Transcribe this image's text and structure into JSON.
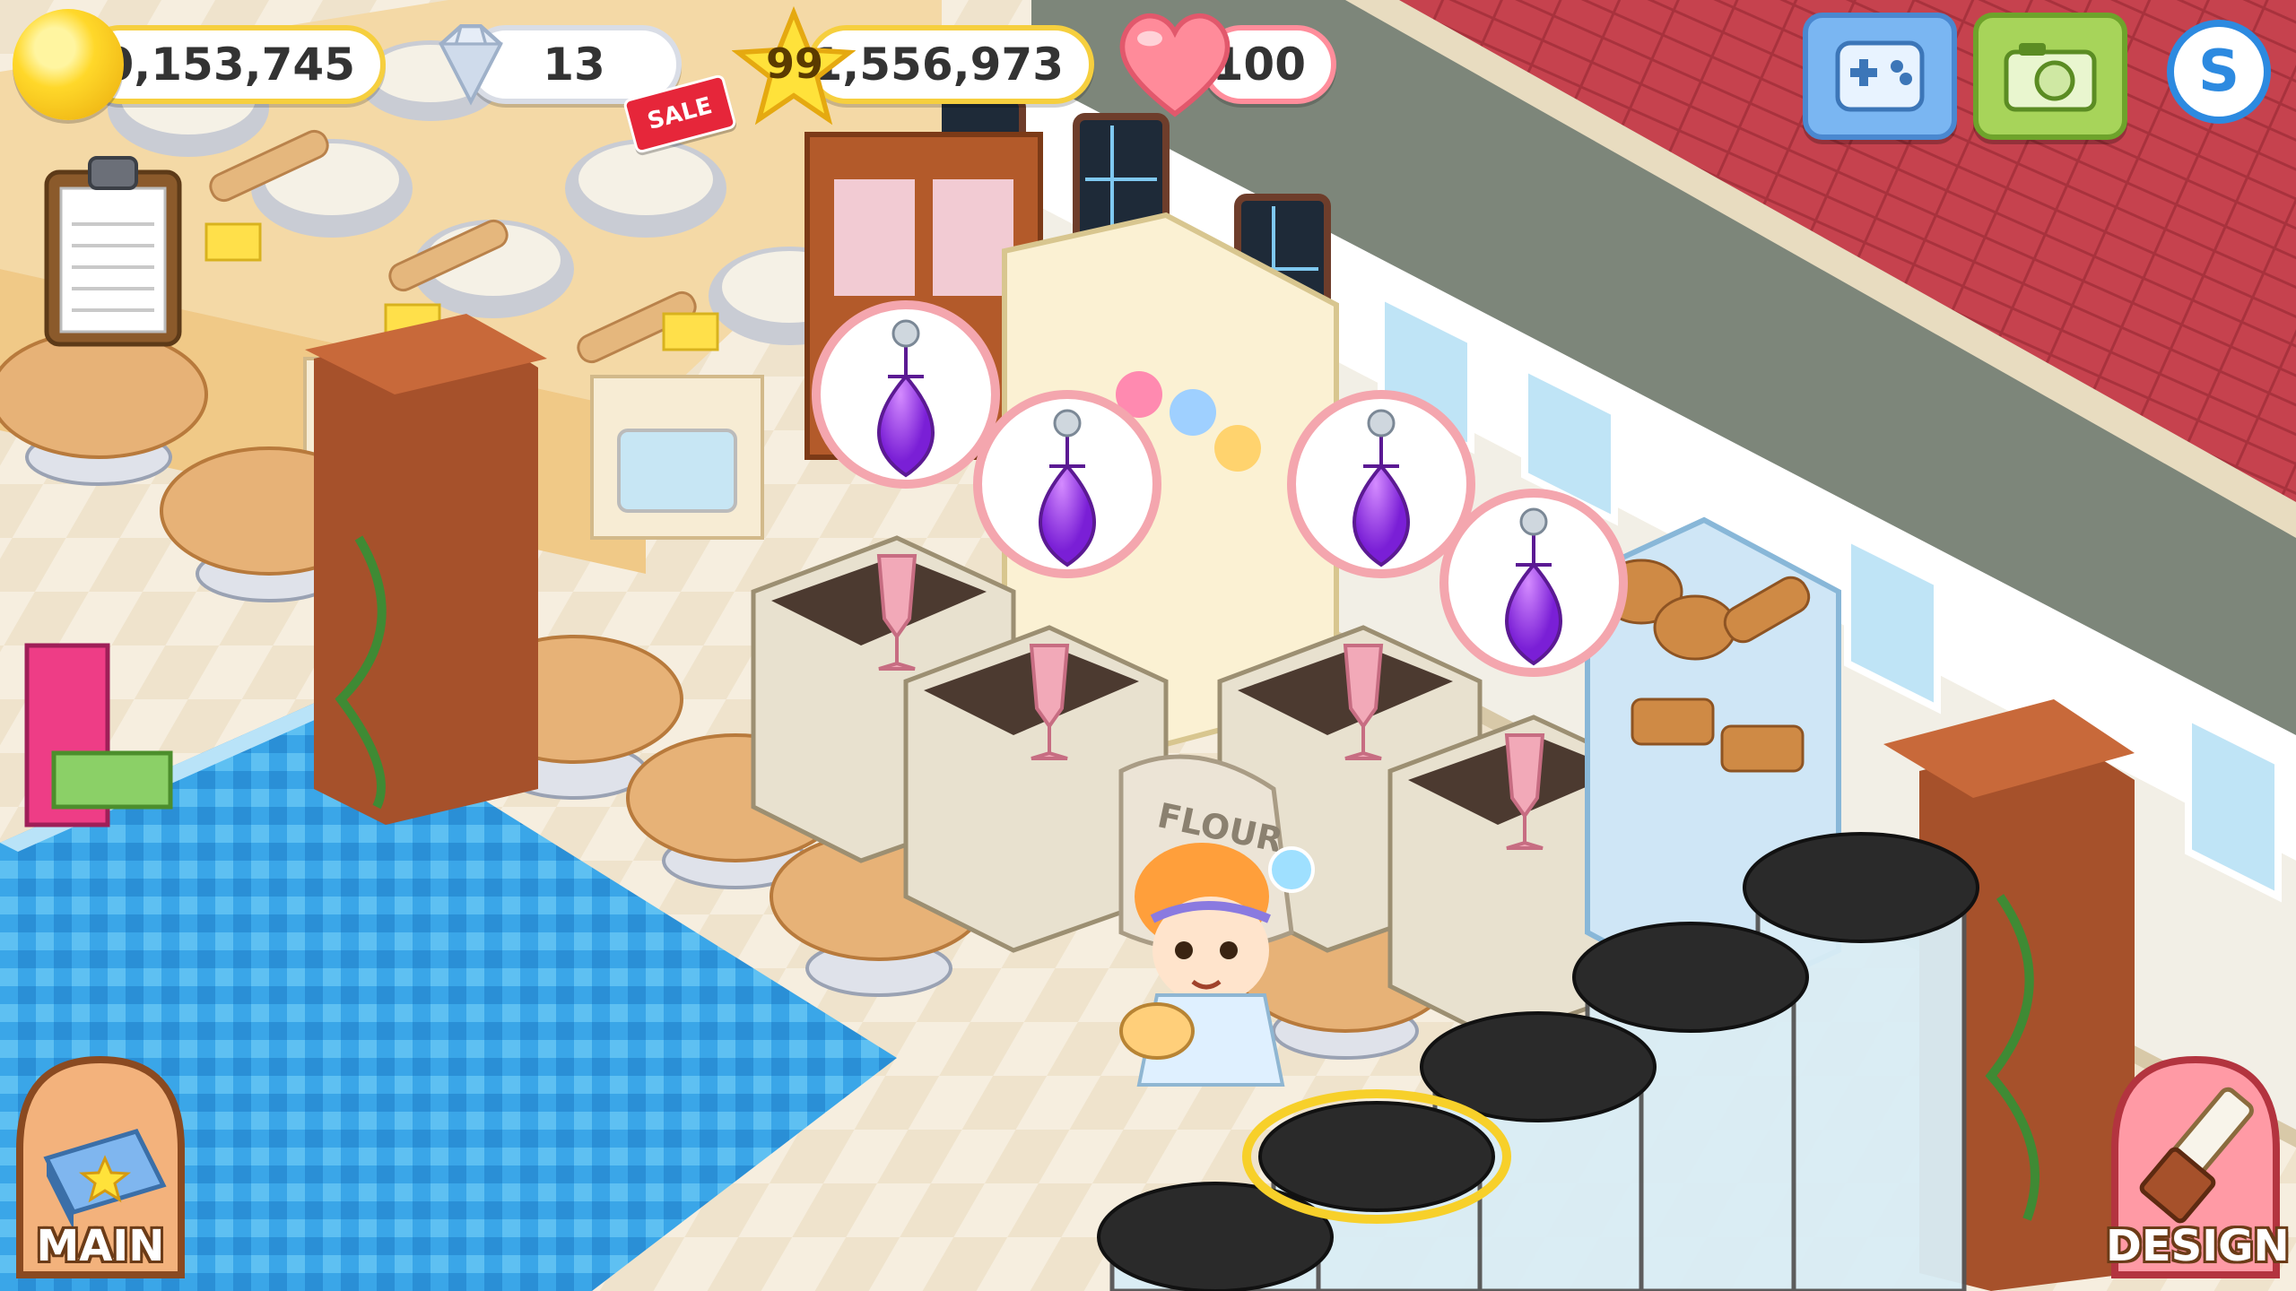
{
  "hud": {
    "coins": "40,153,745",
    "gems": "13",
    "sale_label": "SALE",
    "level": "99",
    "experience": "1,556,973",
    "hearts": "100"
  },
  "buttons": {
    "main_label": "MAIN",
    "design_label": "DESIGN"
  },
  "scene": {
    "sack_label": "FLOUR"
  },
  "icons": {
    "coin": "coin-icon",
    "gem": "diamond-icon",
    "level": "star-icon",
    "heart": "heart-icon",
    "phone": "game-controller-phone-icon",
    "camera": "camera-icon",
    "social": "social-s-icon",
    "clipboard": "clipboard-icon",
    "potion": "purple-potion-icon"
  },
  "colors": {
    "floor_cream": "#f4ead8",
    "floor_blue": "#3aa6e8",
    "wall_red": "#c6424e",
    "wood": "#a6512b",
    "potion_purple": "#8a2be2",
    "pill_border_gold": "#f6cf3e",
    "pill_border_pink": "#ff8d9b"
  }
}
